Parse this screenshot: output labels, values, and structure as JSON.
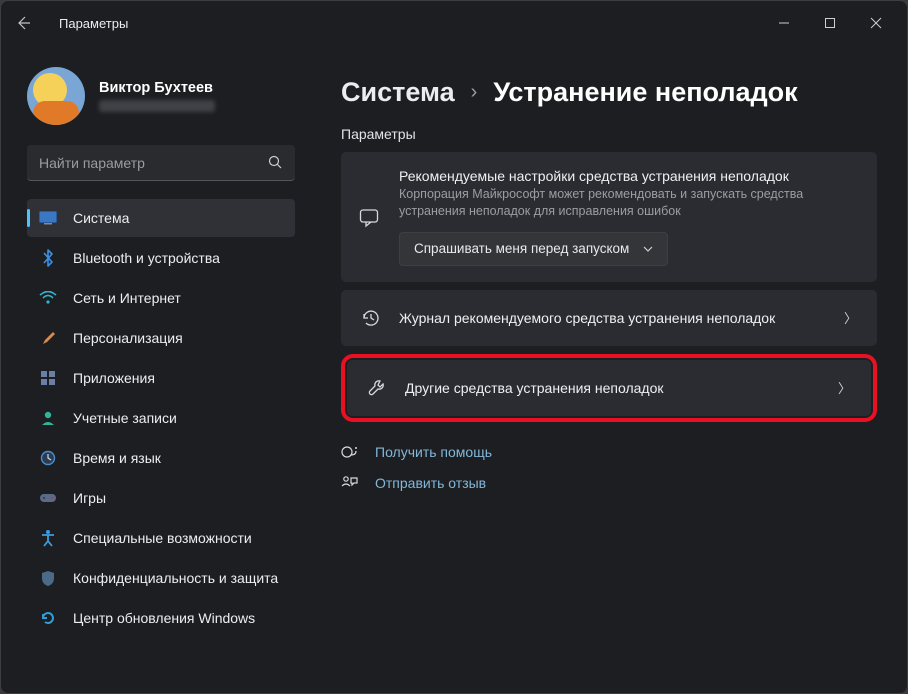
{
  "titlebar": {
    "title": "Параметры"
  },
  "user": {
    "name": "Виктор Бухтеев"
  },
  "search": {
    "placeholder": "Найти параметр"
  },
  "nav": [
    {
      "label": "Система",
      "icon": "system"
    },
    {
      "label": "Bluetooth и устройства",
      "icon": "bluetooth"
    },
    {
      "label": "Сеть и Интернет",
      "icon": "wifi"
    },
    {
      "label": "Персонализация",
      "icon": "brush"
    },
    {
      "label": "Приложения",
      "icon": "apps"
    },
    {
      "label": "Учетные записи",
      "icon": "account"
    },
    {
      "label": "Время и язык",
      "icon": "time"
    },
    {
      "label": "Игры",
      "icon": "games"
    },
    {
      "label": "Специальные возможности",
      "icon": "accessibility"
    },
    {
      "label": "Конфиденциальность и защита",
      "icon": "privacy"
    },
    {
      "label": "Центр обновления Windows",
      "icon": "update"
    }
  ],
  "breadcrumb": {
    "parent": "Система",
    "current": "Устранение неполадок"
  },
  "section_label": "Параметры",
  "card_recommended": {
    "title": "Рекомендуемые настройки средства устранения неполадок",
    "subtitle": "Корпорация Майкрософт может рекомендовать и запускать средства устранения неполадок для исправления ошибок",
    "dropdown": "Спрашивать меня перед запуском"
  },
  "card_history": {
    "label": "Журнал рекомендуемого средства устранения неполадок"
  },
  "card_other": {
    "label": "Другие средства устранения неполадок"
  },
  "links": {
    "help": "Получить помощь",
    "feedback": "Отправить отзыв"
  }
}
